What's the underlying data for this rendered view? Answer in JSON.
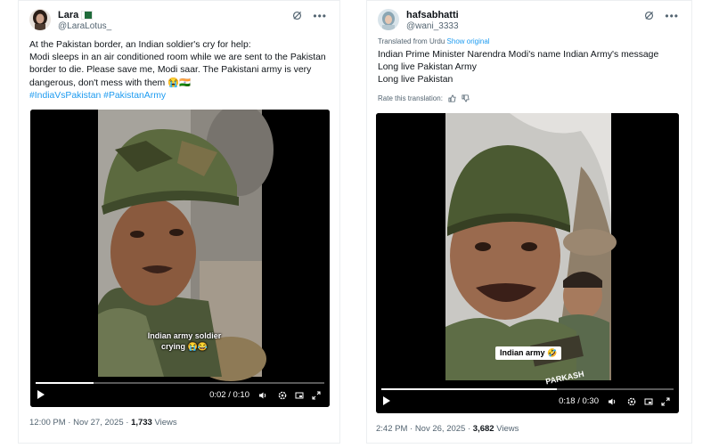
{
  "left_tweet": {
    "display_name": "Lara",
    "handle": "@LaraLotus_",
    "text_lines": [
      "At the Pakistan border, an Indian soldier's cry for help:",
      "Modi sleeps in an air conditioned room while we are sent to the Pakistan",
      "border to die. Please save me, Modi saar. The Pakistani army is very",
      "dangerous, don't mess with them 😭🇮🇳"
    ],
    "hashtags": "#IndiaVsPakistan #PakistanArmy",
    "video_caption_line1": "Indian army soldier",
    "video_caption_line2": "crying 😭😂",
    "video_time": "0:02 / 0:10",
    "video_progress": 0.2,
    "footer_time": "12:00 PM · Nov 27, 2025 · ",
    "views_count": "1,733",
    "views_label": " Views"
  },
  "right_tweet": {
    "display_name": "hafsabhatti",
    "handle": "@wani_3333",
    "translated_label": "Translated from Urdu",
    "show_original": "Show original",
    "text_lines": [
      "Indian Prime Minister Narendra Modi's name Indian Army's message",
      "Long live Pakistan Army",
      "Long live Pakistan"
    ],
    "rate_label": "Rate this translation:",
    "video_badge": "Indian army 🤣",
    "name_tape": "PARKASH",
    "video_time": "0:18 / 0:30",
    "video_progress": 0.6,
    "footer_time": "2:42 PM · Nov 26, 2025 · ",
    "views_count": "3,682",
    "views_label": " Views"
  },
  "colors": {
    "link": "#1d9bf0",
    "muted": "#536471",
    "text": "#0f1419"
  },
  "icons": [
    "grok-icon",
    "more-icon",
    "play-icon",
    "volume-icon",
    "settings-icon",
    "fullscreen-icon",
    "expand-icon",
    "thumbs-up-icon",
    "thumbs-down-icon"
  ]
}
